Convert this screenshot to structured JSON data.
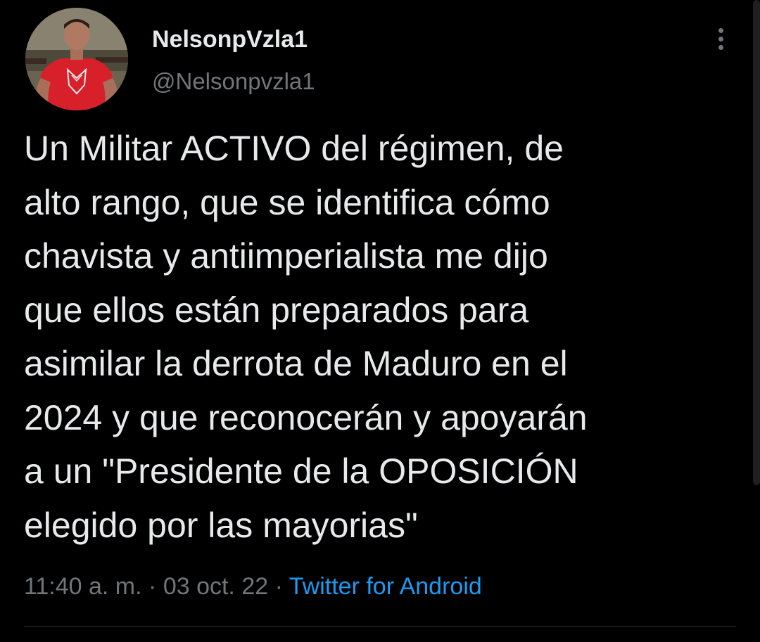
{
  "author": {
    "display_name": "NelsonpVzla1",
    "handle": "@Nelsonpvzla1"
  },
  "tweet": {
    "lines": [
      "Un Militar ACTIVO del régimen, de",
      "alto rango, que se identifica cómo",
      "chavista y antiimperialista me dijo",
      "que ellos están preparados para",
      "asimilar la derrota de Maduro en el",
      "2024 y que reconocerán y apoyarán",
      "a un \"Presidente de la OPOSICIÓN",
      "elegido por las mayorias\""
    ]
  },
  "meta": {
    "time": "11:40 a. m.",
    "separator": "·",
    "date": "03 oct. 22",
    "source": "Twitter for Android"
  },
  "icons": {
    "more": "more-vertical-icon",
    "avatar": "profile-photo"
  },
  "colors": {
    "background": "#000000",
    "primary_text": "#e7e9ea",
    "secondary_text": "#71767b",
    "link": "#1d9bf0",
    "divider": "#2f3336"
  }
}
